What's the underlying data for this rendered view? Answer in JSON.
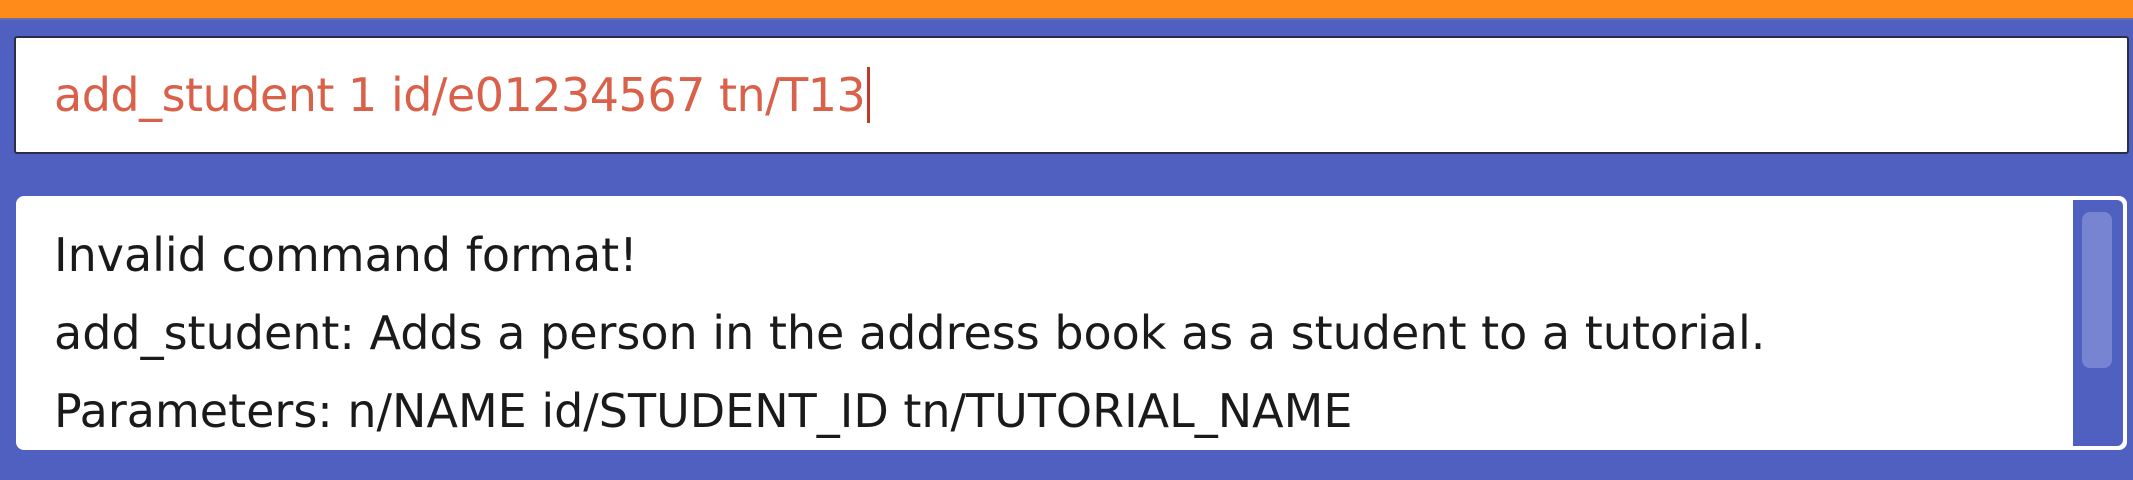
{
  "colors": {
    "top_bar": "#FF8C1A",
    "background": "#5060C0",
    "command_text": "#D9614A",
    "result_text": "#1A1A1A",
    "scrollbar_thumb": "#7784D2"
  },
  "command_box": {
    "value": "add_student 1 id/e01234567 tn/T13"
  },
  "result_display": {
    "lines": [
      "Invalid command format!",
      "add_student: Adds a person in the address book as a student to a tutorial.",
      "Parameters: n/NAME id/STUDENT_ID tn/TUTORIAL_NAME"
    ]
  }
}
